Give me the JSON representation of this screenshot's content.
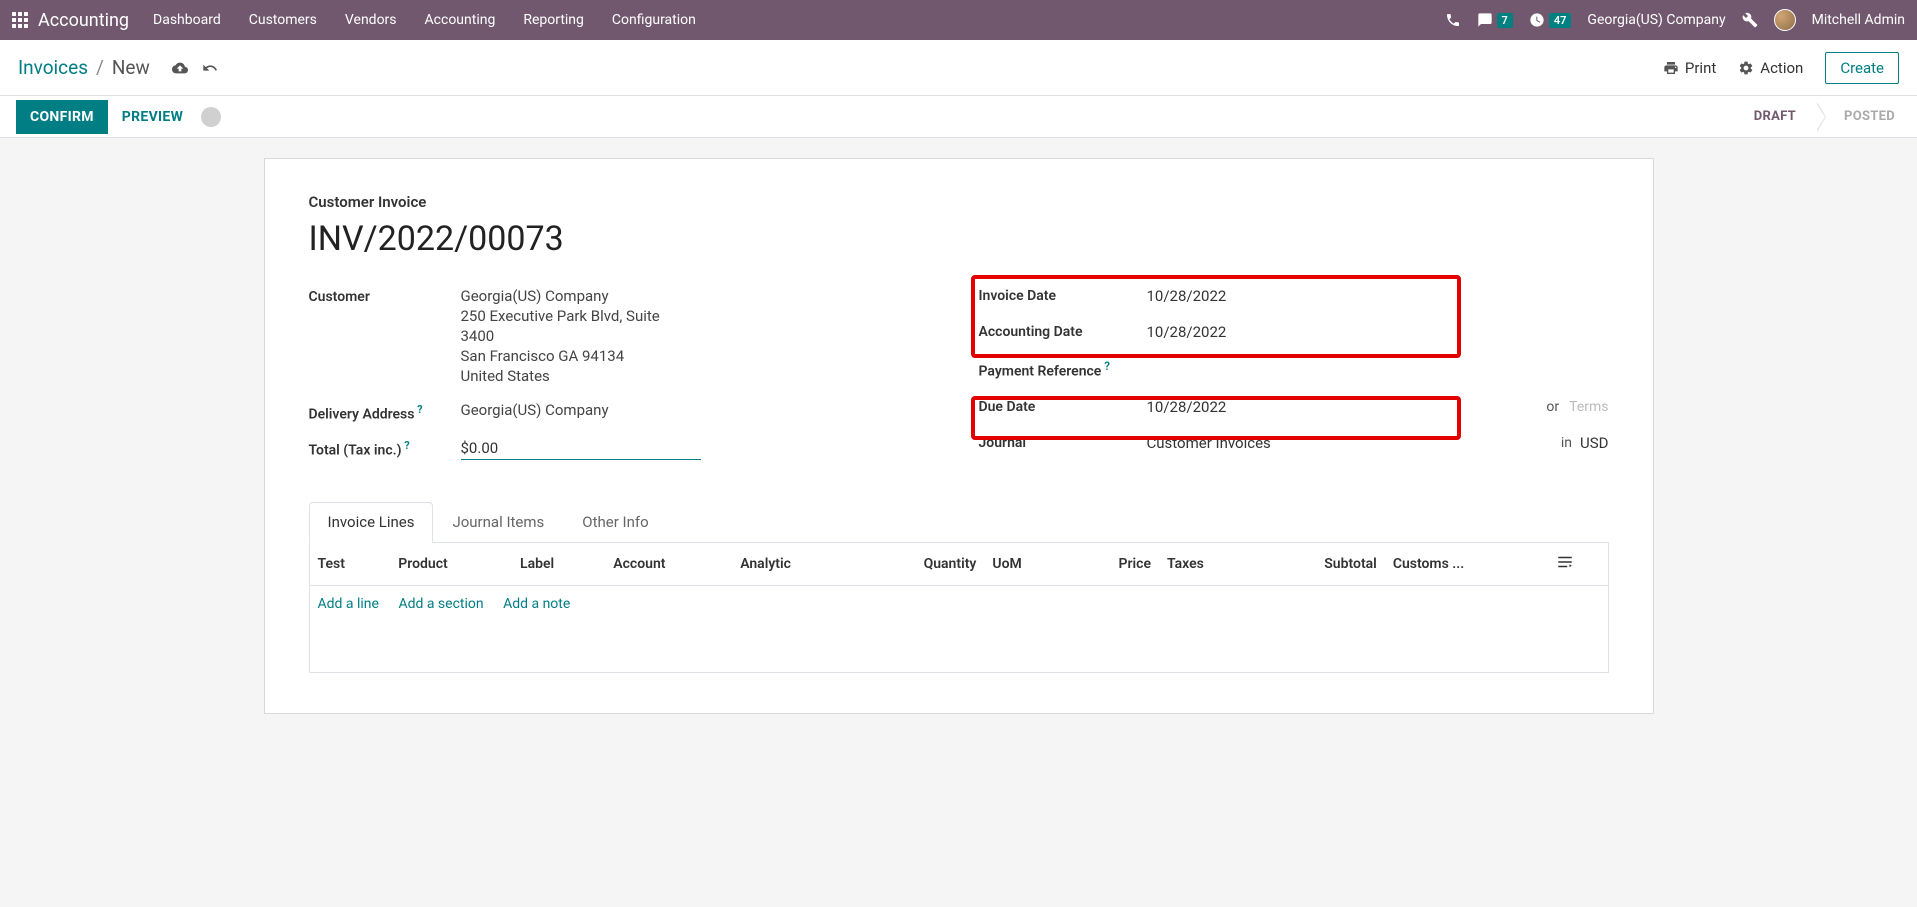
{
  "navbar": {
    "brand": "Accounting",
    "menu": [
      "Dashboard",
      "Customers",
      "Vendors",
      "Accounting",
      "Reporting",
      "Configuration"
    ],
    "msg_count": "7",
    "clock_count": "47",
    "company": "Georgia(US) Company",
    "user": "Mitchell Admin"
  },
  "breadcrumb": {
    "root": "Invoices",
    "current": "New"
  },
  "toolbar": {
    "print": "Print",
    "action": "Action",
    "create": "Create"
  },
  "status": {
    "confirm": "CONFIRM",
    "preview": "PREVIEW",
    "steps": [
      "DRAFT",
      "POSTED"
    ],
    "active_step": 0
  },
  "form": {
    "small_title": "Customer Invoice",
    "big_title": "INV/2022/00073",
    "customer_label": "Customer",
    "customer_name": "Georgia(US) Company",
    "customer_addr": [
      "250 Executive Park Blvd, Suite",
      "3400",
      "San Francisco GA 94134",
      "United States"
    ],
    "delivery_label": "Delivery Address",
    "delivery_value": "Georgia(US) Company",
    "total_label": "Total (Tax inc.)",
    "total_value": "$0.00",
    "invoice_date_label": "Invoice Date",
    "invoice_date": "10/28/2022",
    "acct_date_label": "Accounting Date",
    "acct_date": "10/28/2022",
    "payref_label": "Payment Reference",
    "due_label": "Due Date",
    "due_date": "10/28/2022",
    "or_text": "or",
    "terms_ph": "Terms",
    "journal_label": "Journal",
    "journal_value": "Customer Invoices",
    "in_text": "in",
    "currency": "USD"
  },
  "tabs": [
    "Invoice Lines",
    "Journal Items",
    "Other Info"
  ],
  "table": {
    "headers": [
      "Test",
      "Product",
      "Label",
      "Account",
      "Analytic",
      "Quantity",
      "UoM",
      "Price",
      "Taxes",
      "Subtotal",
      "Customs ..."
    ],
    "add_line": "Add a line",
    "add_section": "Add a section",
    "add_note": "Add a note"
  }
}
